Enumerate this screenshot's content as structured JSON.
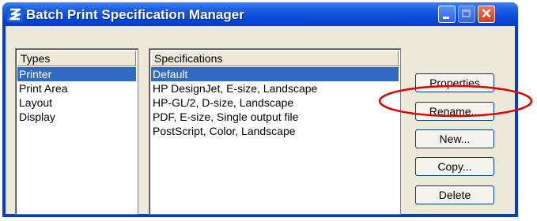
{
  "window": {
    "title": "Batch Print Specification Manager",
    "icon": "app-icon"
  },
  "types": {
    "header": "Types",
    "items": [
      "Printer",
      "Print Area",
      "Layout",
      "Display"
    ],
    "selected": 0
  },
  "specifications": {
    "header": "Specifications",
    "items": [
      "Default",
      "HP DesignJet, E-size, Landscape",
      "HP-GL/2, D-size, Landscape",
      "PDF, E-size, Single output file",
      "PostScript, Color, Landscape"
    ],
    "selected": 0
  },
  "buttons": {
    "properties": "Properties",
    "rename": "Rename...",
    "new": "New...",
    "copy": "Copy...",
    "delete": "Delete"
  },
  "colors": {
    "titlebar": "#0a48d8",
    "selection": "#316ac5",
    "annotation": "#e00000"
  }
}
